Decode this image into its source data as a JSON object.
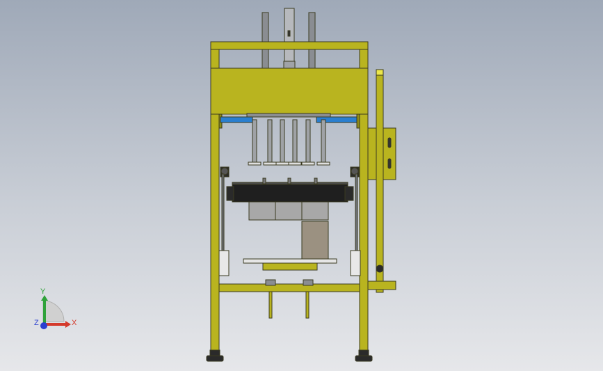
{
  "viewport": {
    "background_top": "#9fa9b8",
    "background_bottom": "#e6e7ea"
  },
  "colors": {
    "frame_yellow": "#b9b41f",
    "frame_dark": "#7f7b10",
    "steel_grey": "#8a8d92",
    "block_grey": "#a8a8a8",
    "block_dark": "#9b9181",
    "belt_black": "#1f1f1f",
    "pneumatic_blue": "#2a7fd0"
  },
  "triad": {
    "x_label": "X",
    "y_label": "Y",
    "z_label": "Z",
    "x_color": "#d43a2c",
    "y_color": "#2fa23a",
    "z_color": "#2a3fd0"
  }
}
